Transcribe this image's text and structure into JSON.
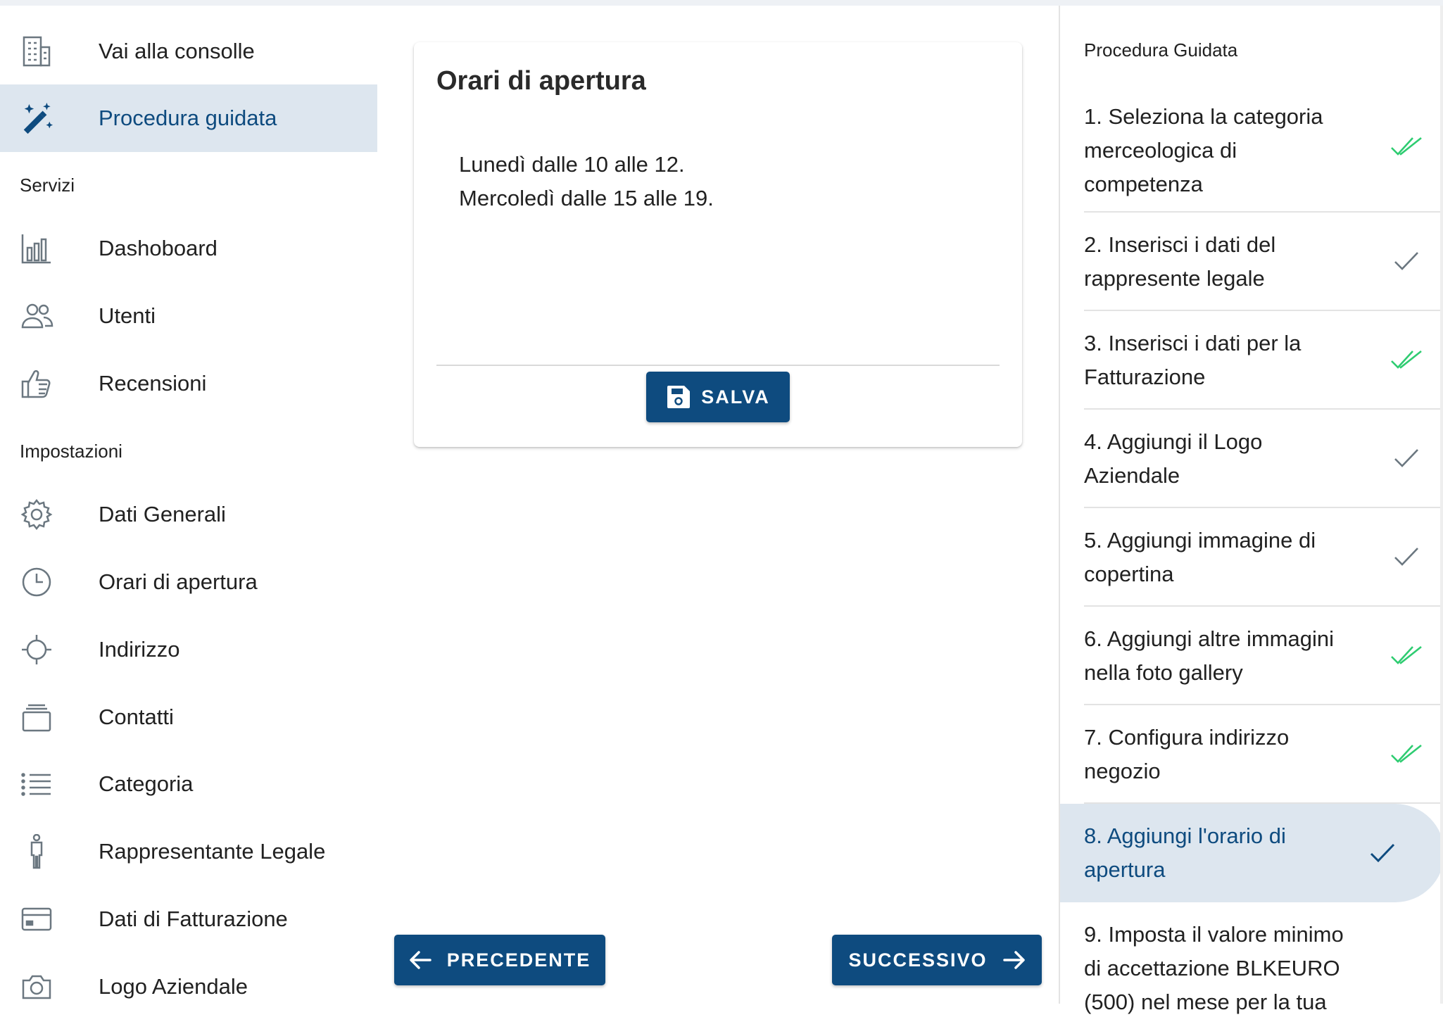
{
  "colors": {
    "primary": "#0e4b7f",
    "active_bg": "#dde6ef",
    "check_done": "#2ecc71",
    "check_grey": "#6b7780"
  },
  "sidebar": {
    "top_items": [
      {
        "label": "Vai alla consolle",
        "icon": "building-icon"
      },
      {
        "label": "Procedura guidata",
        "icon": "magic-wand-icon",
        "active": true
      }
    ],
    "sections": [
      {
        "title": "Servizi",
        "items": [
          {
            "label": "Dashoboard",
            "icon": "bar-chart-icon"
          },
          {
            "label": "Utenti",
            "icon": "users-icon"
          },
          {
            "label": "Recensioni",
            "icon": "thumbs-up-icon"
          }
        ]
      },
      {
        "title": "Impostazioni",
        "items": [
          {
            "label": "Dati Generali",
            "icon": "gear-icon"
          },
          {
            "label": "Orari di apertura",
            "icon": "clock-icon"
          },
          {
            "label": "Indirizzo",
            "icon": "crosshair-icon"
          },
          {
            "label": "Contatti",
            "icon": "cards-stack-icon"
          },
          {
            "label": "Categoria",
            "icon": "list-icon"
          },
          {
            "label": "Rappresentante Legale",
            "icon": "person-icon"
          },
          {
            "label": "Dati di Fatturazione",
            "icon": "credit-card-icon"
          },
          {
            "label": "Logo Aziendale",
            "icon": "camera-icon"
          }
        ]
      }
    ]
  },
  "card": {
    "title": "Orari di apertura",
    "lines": [
      "Lunedì dalle 10 alle 12.",
      "Mercoledì dalle 15 alle 19."
    ],
    "save_label": "SALVA"
  },
  "nav_buttons": {
    "prev_label": "PRECEDENTE",
    "next_label": "SUCCESSIVO"
  },
  "wizard": {
    "title": "Procedura Guidata",
    "steps": [
      {
        "lines": [
          "1. Seleziona la categoria",
          "merceologica di",
          "competenza"
        ],
        "status": "done"
      },
      {
        "lines": [
          "2. Inserisci i dati del",
          "rappresente legale"
        ],
        "status": "checked"
      },
      {
        "lines": [
          "3. Inserisci i dati per la",
          "Fatturazione"
        ],
        "status": "done"
      },
      {
        "lines": [
          "4. Aggiungi il Logo",
          "Aziendale"
        ],
        "status": "checked"
      },
      {
        "lines": [
          "5. Aggiungi immagine di",
          "copertina"
        ],
        "status": "checked"
      },
      {
        "lines": [
          "6. Aggiungi altre immagini",
          "nella foto gallery"
        ],
        "status": "done"
      },
      {
        "lines": [
          "7. Configura indirizzo",
          "negozio"
        ],
        "status": "done"
      },
      {
        "lines": [
          "8. Aggiungi l'orario di",
          "apertura"
        ],
        "status": "active"
      },
      {
        "lines": [
          "9. Imposta il valore minimo",
          "di accettazione BLKEURO",
          "(500) nel mese per la tua"
        ],
        "status": "pending"
      }
    ]
  }
}
